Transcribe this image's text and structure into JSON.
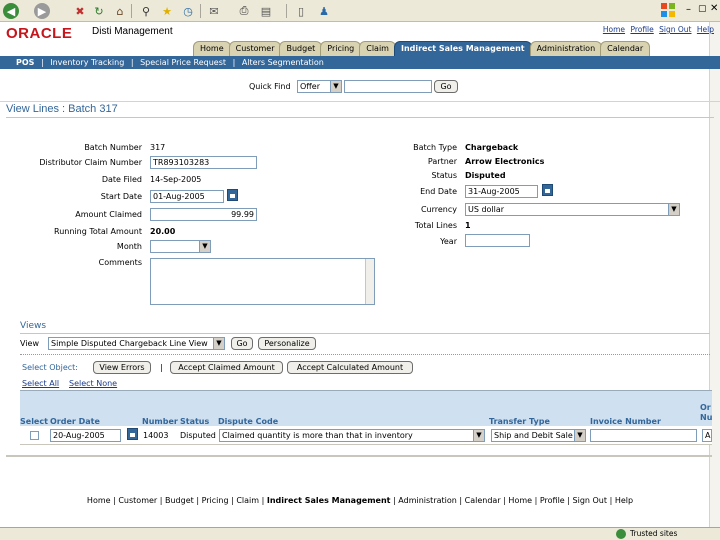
{
  "header": {
    "logo": "ORACLE",
    "app_title": "Disti Management",
    "global_links": [
      "Home",
      "Profile",
      "Sign Out",
      "Help"
    ]
  },
  "tabs": [
    "Home",
    "Customer",
    "Budget",
    "Pricing",
    "Claim",
    "Indirect Sales Management",
    "Administration",
    "Calendar"
  ],
  "active_tab": "Indirect Sales Management",
  "subnav": [
    "POS",
    "|",
    "Inventory Tracking",
    "|",
    "Special Price Request",
    "|",
    "Alters Segmentation"
  ],
  "quick_find": {
    "label": "Quick Find",
    "select_value": "Offer",
    "go": "Go"
  },
  "page_title": "View Lines : Batch 317",
  "form_left": {
    "batch_number_label": "Batch Number",
    "batch_number": "317",
    "claim_number_label": "Distributor Claim Number",
    "claim_number": "TR893103283",
    "date_filed_label": "Date Filed",
    "date_filed": "14-Sep-2005",
    "start_date_label": "Start Date",
    "start_date": "01-Aug-2005",
    "amount_claimed_label": "Amount Claimed",
    "amount_claimed": "99.99",
    "running_total_label": "Running Total Amount",
    "running_total": "20.00",
    "month_label": "Month",
    "comments_label": "Comments"
  },
  "form_right": {
    "batch_type_label": "Batch Type",
    "batch_type": "Chargeback",
    "partner_label": "Partner",
    "partner": "Arrow Electronics",
    "status_label": "Status",
    "status": "Disputed",
    "end_date_label": "End Date",
    "end_date": "31-Aug-2005",
    "currency_label": "Currency",
    "currency": "US dollar",
    "total_lines_label": "Total Lines",
    "total_lines": "1",
    "year_label": "Year"
  },
  "views": {
    "header": "Views",
    "view_label": "View",
    "view_value": "Simple Disputed Chargeback Line View",
    "go": "Go",
    "personalize": "Personalize"
  },
  "actions": {
    "select_object": "Select Object:",
    "view_errors": "View Errors",
    "separator": "|",
    "accept_claimed": "Accept Claimed Amount",
    "accept_calculated": "Accept Calculated Amount",
    "select_all": "Select All",
    "select_none": "Select None"
  },
  "table": {
    "headers": [
      "Select",
      "Order Date",
      "Number",
      "Status",
      "Dispute Code",
      "Transfer Type",
      "Invoice Number",
      "Or\nNu"
    ],
    "row": {
      "order_date": "20-Aug-2005",
      "number": "14003",
      "status": "Disputed",
      "dispute_code": "Claimed quantity is more than that in inventory",
      "transfer_type": "Ship and Debit Sale",
      "invoice_number": "",
      "cut_off": "A"
    }
  },
  "footer_links": [
    "Home",
    "|",
    "Customer",
    "|",
    "Budget",
    "|",
    "Pricing",
    "|",
    "Claim",
    "|",
    "Indirect Sales Management",
    "|",
    "Administration",
    "|",
    "Calendar",
    "|",
    "Home",
    "|",
    "Profile",
    "|",
    "Sign Out",
    "|",
    "Help"
  ],
  "statusbar": {
    "zone": "Trusted sites"
  },
  "colors": {
    "brand_red": "#c4161c",
    "nav_blue": "#336699",
    "table_header": "#cfe0f1"
  }
}
